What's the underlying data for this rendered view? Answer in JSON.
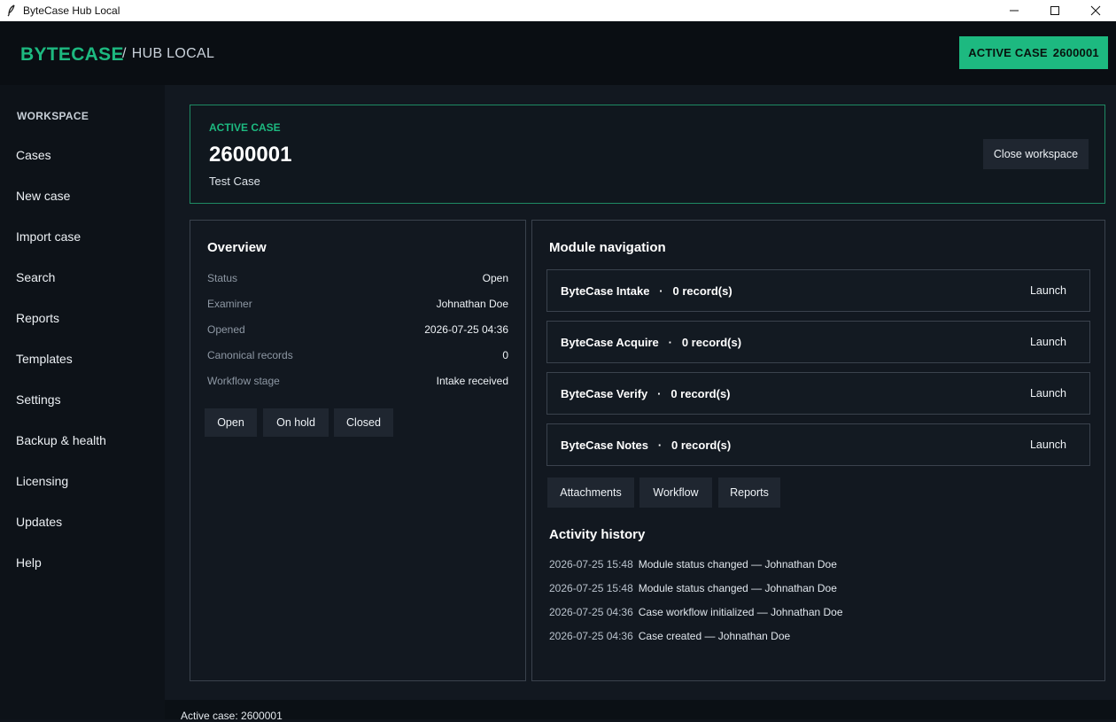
{
  "window": {
    "title": "ByteCase Hub Local",
    "icon": "feather-icon"
  },
  "header": {
    "brand": "BYTECASE",
    "subtitle_slash": "/",
    "subtitle": "HUB LOCAL",
    "badge_label": "ACTIVE CASE",
    "badge_value": "2600001"
  },
  "sidebar": {
    "section_label": "WORKSPACE",
    "items": [
      {
        "label": "Cases"
      },
      {
        "label": "New case"
      },
      {
        "label": "Import case"
      },
      {
        "label": "Search"
      },
      {
        "label": "Reports"
      },
      {
        "label": "Templates"
      },
      {
        "label": "Settings"
      },
      {
        "label": "Backup & health"
      },
      {
        "label": "Licensing"
      },
      {
        "label": "Updates"
      },
      {
        "label": "Help"
      }
    ]
  },
  "case_card": {
    "eyebrow": "ACTIVE CASE",
    "case_id": "2600001",
    "case_name": "Test Case",
    "close_button": "Close workspace"
  },
  "overview": {
    "title": "Overview",
    "rows": [
      {
        "key": "Status",
        "value": "Open"
      },
      {
        "key": "Examiner",
        "value": "Johnathan Doe"
      },
      {
        "key": "Opened",
        "value": "2026-07-25 04:36"
      },
      {
        "key": "Canonical records",
        "value": "0"
      },
      {
        "key": "Workflow stage",
        "value": "Intake received"
      }
    ],
    "status_buttons": [
      "Open",
      "On hold",
      "Closed"
    ]
  },
  "modules": {
    "title": "Module navigation",
    "separator": "·",
    "items": [
      {
        "name": "ByteCase Intake",
        "records": "0 record(s)",
        "action": "Launch"
      },
      {
        "name": "ByteCase Acquire",
        "records": "0 record(s)",
        "action": "Launch"
      },
      {
        "name": "ByteCase Verify",
        "records": "0 record(s)",
        "action": "Launch"
      },
      {
        "name": "ByteCase Notes",
        "records": "0 record(s)",
        "action": "Launch"
      }
    ],
    "actions": [
      "Attachments",
      "Workflow",
      "Reports"
    ]
  },
  "activity": {
    "title": "Activity history",
    "items": [
      {
        "time": "2026-07-25 15:48",
        "text": "Module status changed — Johnathan Doe"
      },
      {
        "time": "2026-07-25 15:48",
        "text": "Module status changed — Johnathan Doe"
      },
      {
        "time": "2026-07-25 04:36",
        "text": "Case workflow initialized — Johnathan Doe"
      },
      {
        "time": "2026-07-25 04:36",
        "text": "Case created — Johnathan Doe"
      }
    ]
  },
  "statusbar": {
    "text": "Active case: 2600001"
  },
  "colors": {
    "accent": "#1db980",
    "background": "#121820",
    "sidebar": "#0d1218",
    "header": "#0a0e13"
  }
}
